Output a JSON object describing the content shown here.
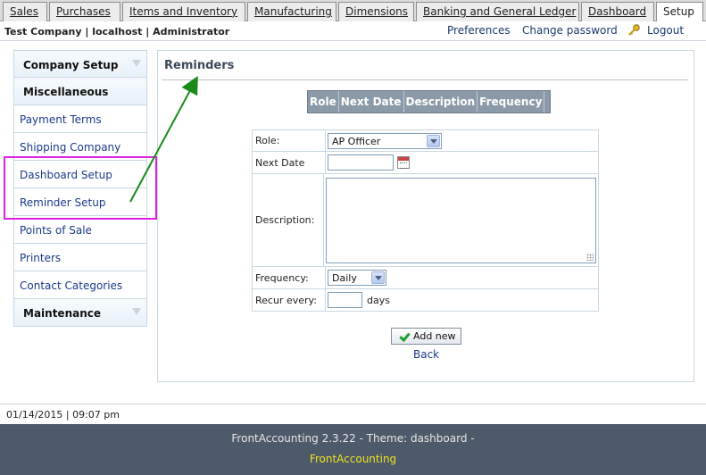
{
  "tabs": [
    {
      "label": "Sales",
      "active": false
    },
    {
      "label": "Purchases",
      "active": false
    },
    {
      "label": "Items and Inventory",
      "active": false
    },
    {
      "label": "Manufacturing",
      "active": false
    },
    {
      "label": "Dimensions",
      "active": false
    },
    {
      "label": "Banking and General Ledger",
      "active": false
    },
    {
      "label": "Dashboard",
      "active": false
    },
    {
      "label": "Setup",
      "active": true
    }
  ],
  "infobar": {
    "company": "Test Company | localhost | Administrator",
    "preferences": "Preferences",
    "change_password": "Change password",
    "logout": "Logout"
  },
  "sidebar": {
    "items": [
      {
        "label": "Company Setup",
        "kind": "header"
      },
      {
        "label": "Miscellaneous",
        "kind": "header"
      },
      {
        "label": "Payment Terms",
        "kind": "link"
      },
      {
        "label": "Shipping Company",
        "kind": "link"
      },
      {
        "label": "Dashboard Setup",
        "kind": "link"
      },
      {
        "label": "Reminder Setup",
        "kind": "link"
      },
      {
        "label": "Points of Sale",
        "kind": "link"
      },
      {
        "label": "Printers",
        "kind": "link"
      },
      {
        "label": "Contact Categories",
        "kind": "link"
      },
      {
        "label": "Maintenance",
        "kind": "header"
      }
    ]
  },
  "main": {
    "title": "Reminders",
    "list_columns": [
      "Role",
      "Next Date",
      "Description",
      "Frequency"
    ],
    "form": {
      "role_label": "Role:",
      "role_value": "AP Officer",
      "next_date_label": "Next Date",
      "next_date_value": "",
      "description_label": "Description:",
      "description_value": "",
      "frequency_label": "Frequency:",
      "frequency_value": "Daily",
      "recur_label": "Recur every:",
      "recur_value": "",
      "recur_unit": "days"
    },
    "add_button": "Add new",
    "back_link": "Back"
  },
  "footer": {
    "datetime": "01/14/2015 | 09:07 pm",
    "version": "FrontAccounting 2.3.22 - Theme: dashboard -",
    "link": "FrontAccounting"
  },
  "colors": {
    "highlight": "#e020e0",
    "annotation_arrow": "#1a8a1a",
    "footer_bg": "#4d5a69",
    "footer_link": "#f0e020"
  }
}
